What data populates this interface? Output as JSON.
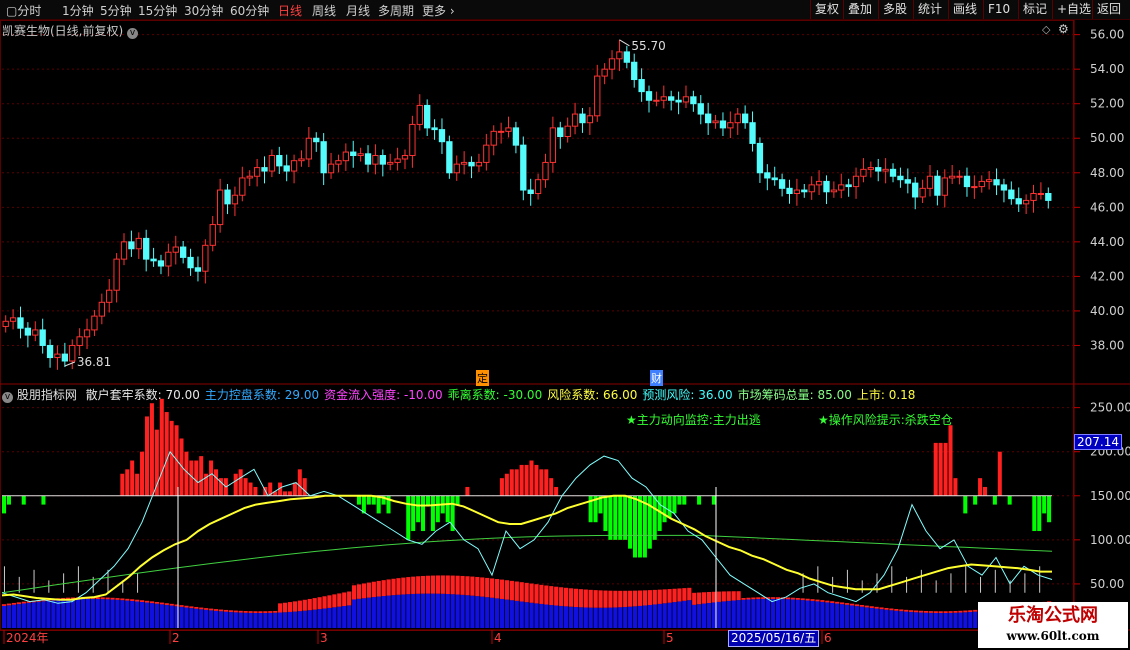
{
  "toolbar": {
    "periods": [
      "分时",
      "1分钟",
      "5分钟",
      "15分钟",
      "30分钟",
      "60分钟",
      "日线",
      "周线",
      "月线",
      "多周期",
      "更多"
    ],
    "active_period": "日线",
    "right_buttons": [
      "复权",
      "叠加",
      "多股",
      "统计",
      "画线",
      "F10",
      "标记",
      "+自选",
      "返回"
    ]
  },
  "chart_title": "凯赛生物(日线,前复权)",
  "sub_indicator_name": "股朋指标网",
  "indicator_values": [
    {
      "label": "散户套牢系数:",
      "value": "70.00",
      "color": "#e8e8e8"
    },
    {
      "label": "主力控盘系数:",
      "value": "29.00",
      "color": "#33aaff"
    },
    {
      "label": "资金流入强度:",
      "value": "-10.00",
      "color": "#ff44ff"
    },
    {
      "label": "乖离系数:",
      "value": "-30.00",
      "color": "#33ff33"
    },
    {
      "label": "风险系数:",
      "value": "66.00",
      "color": "#ffff44"
    },
    {
      "label": "预测风险:",
      "value": "36.00",
      "color": "#44ffff"
    },
    {
      "label": "市场筹码总量:",
      "value": "85.00",
      "color": "#88ff88"
    },
    {
      "label": "上市:",
      "value": "0.18",
      "color": "#ffff44"
    }
  ],
  "annotations": [
    "★主力动向监控:主力出逃",
    "★操作风险提示:杀跌空仓"
  ],
  "markers": [
    "定",
    "财"
  ],
  "price_high_label": "55.70",
  "price_low_label": "36.81",
  "right_value_label": "207.14",
  "x_axis_labels": [
    "2024年",
    "2",
    "3",
    "4",
    "5",
    "6"
  ],
  "cursor_date": "2025/05/16/五",
  "watermark": {
    "line1": "乐淘公式网",
    "line2": "www.60lt.com"
  },
  "colors": {
    "up": "#ff3232",
    "down": "#54fcfc",
    "bull_bar": "#ff2020",
    "bear_bar": "#00ff00",
    "yellow_line": "#ffff30",
    "cyan_line": "#80ffff",
    "green_line": "#40d040",
    "blue_fill": "#1010e0",
    "red_fill": "#ff2020",
    "grid": "#5a0000"
  },
  "chart_data": [
    {
      "type": "candlestick",
      "title": "凯赛生物(日线,前复权)",
      "y_ticks": [
        38.0,
        40.0,
        42.0,
        44.0,
        46.0,
        48.0,
        50.0,
        52.0,
        54.0,
        56.0
      ],
      "ylim": [
        36.0,
        56.5
      ],
      "high": 55.7,
      "low": 36.81,
      "closes": [
        39.4,
        39.6,
        39.0,
        38.6,
        38.9,
        38.0,
        37.3,
        37.5,
        37.1,
        38.0,
        38.5,
        38.9,
        39.7,
        40.5,
        41.2,
        43.0,
        44.0,
        43.6,
        44.2,
        43.0,
        42.9,
        42.6,
        43.4,
        43.7,
        43.1,
        42.5,
        42.3,
        43.8,
        45.0,
        47.0,
        46.2,
        46.7,
        47.7,
        47.8,
        48.3,
        48.1,
        49.0,
        48.4,
        48.1,
        48.7,
        48.8,
        50.0,
        49.8,
        48.0,
        48.5,
        48.7,
        49.2,
        49.0,
        49.1,
        48.5,
        49.0,
        48.5,
        48.6,
        48.8,
        49.0,
        50.8,
        51.9,
        50.6,
        50.5,
        49.8,
        48.0,
        48.5,
        48.6,
        48.4,
        48.6,
        49.6,
        50.4,
        50.4,
        50.6,
        49.6,
        47.0,
        46.8,
        47.6,
        48.6,
        50.6,
        50.1,
        50.7,
        51.4,
        50.9,
        51.3,
        53.6,
        54.0,
        54.6,
        55.0,
        54.4,
        53.4,
        52.7,
        52.2,
        52.2,
        52.4,
        52.2,
        52.1,
        52.4,
        52.0,
        51.4,
        50.9,
        51.0,
        50.6,
        50.9,
        51.4,
        50.9,
        49.7,
        48.0,
        47.7,
        47.6,
        47.1,
        46.8,
        47.0,
        46.9,
        47.3,
        47.5,
        46.9,
        47.0,
        47.3,
        47.2,
        47.8,
        48.2,
        48.3,
        48.1,
        48.2,
        47.8,
        47.6,
        47.4,
        46.6,
        47.1,
        47.8,
        46.7,
        47.7,
        47.8,
        47.8,
        47.2,
        47.2,
        47.5,
        47.6,
        47.3,
        47.0,
        46.5,
        46.2,
        46.4,
        46.8,
        46.8,
        46.4
      ]
    },
    {
      "type": "bar",
      "title": "股朋指标网",
      "y_ticks": [
        50.0,
        100.0,
        150.0,
        200.0,
        250.0
      ],
      "ylim": [
        0,
        270
      ],
      "baseline": 150,
      "bars": [
        130,
        140,
        150,
        150,
        140,
        150,
        150,
        150,
        140,
        150,
        150,
        150,
        150,
        150,
        150,
        150,
        150,
        150,
        150,
        150,
        150,
        150,
        150,
        150,
        175,
        180,
        190,
        175,
        200,
        240,
        255,
        225,
        260,
        245,
        235,
        230,
        215,
        200,
        190,
        190,
        195,
        175,
        190,
        180,
        170,
        170,
        150,
        175,
        180,
        170,
        165,
        160,
        150,
        160,
        165,
        155,
        165,
        155,
        155,
        165,
        180,
        170,
        150,
        150,
        150,
        150,
        150,
        150,
        150,
        150,
        150,
        150,
        140,
        130,
        140,
        140,
        130,
        140,
        130,
        150,
        150,
        150,
        100,
        110,
        120,
        110,
        140,
        110,
        120,
        130,
        120,
        110,
        140,
        150,
        160,
        150,
        150,
        150,
        150,
        150,
        150,
        170,
        175,
        180,
        180,
        185,
        185,
        190,
        185,
        180,
        180,
        170,
        160,
        150,
        150,
        150,
        150,
        150,
        150,
        120,
        120,
        130,
        110,
        100,
        100,
        100,
        100,
        90,
        80,
        80,
        80,
        90,
        100,
        110,
        120,
        125,
        130,
        140,
        140,
        150,
        150,
        140,
        150,
        150,
        140,
        150,
        150,
        150,
        150,
        150,
        150,
        150,
        150,
        150,
        150,
        150,
        150,
        150,
        150,
        150,
        150,
        150,
        150,
        150,
        150,
        150,
        150,
        150,
        150,
        150,
        150,
        150,
        150,
        150,
        150,
        150,
        150,
        150,
        150,
        150,
        150,
        150,
        150,
        150,
        150,
        150,
        150,
        150,
        150,
        210,
        210,
        210,
        230,
        170,
        150,
        130,
        150,
        140,
        170,
        160,
        150,
        140,
        200,
        150,
        140,
        150,
        150,
        150,
        150,
        110,
        110,
        130,
        120
      ]
    },
    {
      "type": "line",
      "name": "yellow",
      "values": [
        37,
        38,
        36,
        34,
        33,
        32,
        32,
        34,
        35,
        38,
        48,
        58,
        70,
        80,
        88,
        95,
        100,
        110,
        118,
        124,
        130,
        136,
        140,
        142,
        144,
        146,
        147,
        148,
        150,
        150,
        150,
        150,
        150,
        148,
        144,
        141,
        139,
        139,
        140,
        141,
        138,
        132,
        126,
        120,
        118,
        118,
        122,
        126,
        130,
        136,
        140,
        144,
        148,
        150,
        150,
        146,
        140,
        132,
        124,
        118,
        112,
        104,
        98,
        92,
        88,
        82,
        78,
        72,
        66,
        62,
        56,
        52,
        48,
        46,
        44,
        44,
        44,
        48,
        52,
        56,
        60,
        64,
        68,
        70,
        72,
        71,
        70,
        69,
        68,
        66,
        64,
        64
      ]
    }
  ]
}
